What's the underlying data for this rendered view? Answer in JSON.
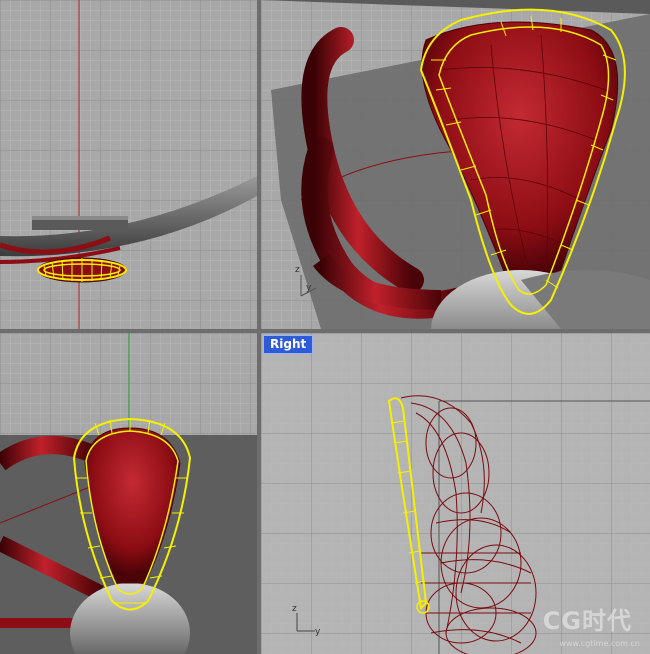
{
  "viewports": {
    "top": {
      "label": ""
    },
    "perspective": {
      "label": ""
    },
    "front": {
      "label": ""
    },
    "right": {
      "label": "Right"
    }
  },
  "axes": {
    "z": "z",
    "y": "y",
    "x": "x"
  },
  "watermark": {
    "text": "CG时代",
    "sub": "www.cgtime.com.cn"
  },
  "colors": {
    "viewport_bg": "#a8a8a8",
    "grid_minor": "#b9b9b9",
    "grid_major": "#8e8e8e",
    "surface_red": "#a3121a",
    "wire_red": "#7a0b10",
    "selection_yellow": "#f5f000",
    "axis_red": "#b22222",
    "axis_green": "#1f9d2f",
    "label_blue": "#2e5bd8"
  },
  "icons": [
    "grid-icon",
    "axis-gizmo-icon"
  ]
}
